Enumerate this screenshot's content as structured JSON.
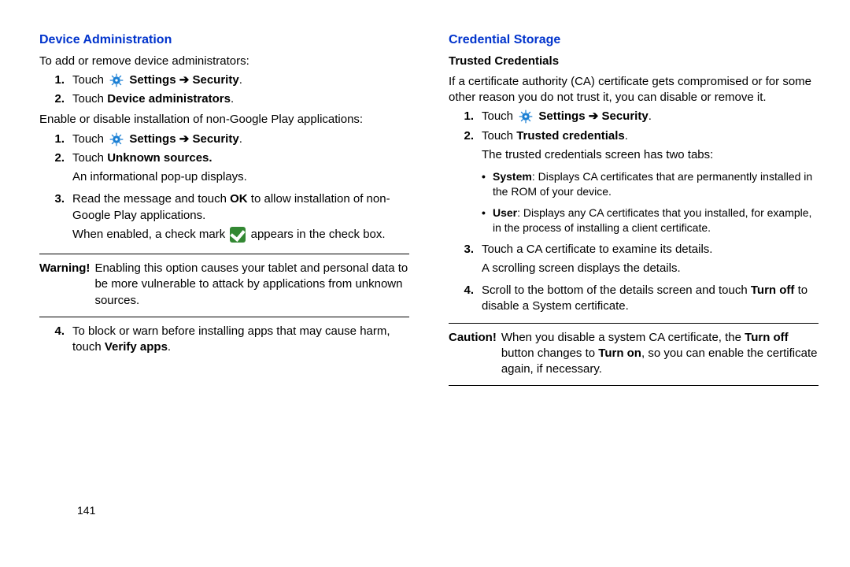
{
  "page_number": "141",
  "left": {
    "section_title": "Device Administration",
    "intro": "To add or remove device administrators:",
    "s1": {
      "num": "1.",
      "touch": "Touch ",
      "settings": "Settings",
      "arrow": "➔",
      "security": "Security",
      "period": "."
    },
    "s2": {
      "num": "2.",
      "pre": "Touch ",
      "bold": "Device administrators",
      "post": "."
    },
    "para2": "Enable or disable installation of non-Google Play applications:",
    "s3": {
      "num": "1.",
      "touch": "Touch ",
      "settings": "Settings",
      "arrow": "➔",
      "security": "Security",
      "period": "."
    },
    "s4": {
      "num": "2.",
      "l1_pre": "Touch ",
      "l1_bold": "Unknown sources.",
      "l2": "An informational pop-up displays."
    },
    "s5": {
      "num": "3.",
      "l1_a": "Read the message and touch ",
      "l1_ok": "OK",
      "l1_b": " to allow installation of non-Google Play applications.",
      "l2_a": "When enabled, a check mark ",
      "l2_b": " appears in the check box."
    },
    "warning": {
      "label": "Warning!",
      "text_a": "Enabling this option causes your tablet and personal data to be more vulnerable to attack by applications from unknown sources."
    },
    "s6": {
      "num": "4.",
      "a": "To block or warn before installing apps that may cause harm, touch ",
      "b": "Verify apps",
      "c": "."
    }
  },
  "right": {
    "section_title": "Credential Storage",
    "subsection": "Trusted Credentials",
    "intro": "If a certificate authority (CA) certificate gets compromised or for some other reason you do not trust it, you can disable or remove it.",
    "s1": {
      "num": "1.",
      "touch": "Touch ",
      "settings": "Settings",
      "arrow": "➔",
      "security": "Security",
      "period": "."
    },
    "s2": {
      "num": "2.",
      "a": "Touch ",
      "b": "Trusted credentials",
      "c": ".",
      "l2": "The trusted credentials screen has two tabs:"
    },
    "bullet1": {
      "label_bold": "System",
      "text": ": Displays CA certificates that are permanently installed in the ROM of your device."
    },
    "bullet2": {
      "label_bold": "User",
      "text": ": Displays any CA certificates that you installed, for example, in the process of installing a client certificate."
    },
    "s3": {
      "num": "3.",
      "l1": "Touch a CA certificate to examine its details.",
      "l2": "A scrolling screen displays the details."
    },
    "s4": {
      "num": "4.",
      "a": "Scroll to the bottom of the details screen and touch ",
      "b": "Turn off",
      "c": " to disable a System certificate."
    },
    "caution": {
      "label": "Caution!",
      "a": "When you disable a system CA certificate, the ",
      "b1": "Turn off",
      "mid": " button changes to ",
      "b2": "Turn on",
      "c": ", so you can enable the certificate again, if necessary."
    }
  }
}
